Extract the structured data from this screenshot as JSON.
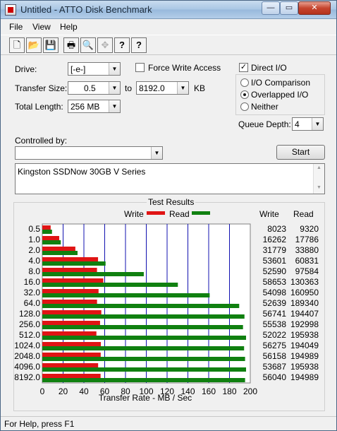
{
  "window": {
    "title": "Untitled - ATTO Disk Benchmark",
    "minimize": "—",
    "maximize": "▭",
    "close": "✕"
  },
  "menu": [
    "File",
    "View",
    "Help"
  ],
  "toolbar": {
    "icons": [
      "new-icon",
      "open-icon",
      "save-icon",
      "print-icon",
      "print-preview-icon",
      "move-icon",
      "help-icon",
      "context-help-icon"
    ],
    "glyphs": [
      "🗋",
      "📂",
      "💾",
      "🖶",
      "🔍",
      "✥",
      "?",
      "?"
    ]
  },
  "settings": {
    "drive_label": "Drive:",
    "drive_value": "[-e-]",
    "force_write_label": "Force Write Access",
    "direct_io_label": "Direct I/O",
    "transfer_size_label": "Transfer Size:",
    "transfer_from": "0.5",
    "to_label": "to",
    "transfer_to": "8192.0",
    "kb_unit": "KB",
    "total_length_label": "Total Length:",
    "total_length_value": "256 MB",
    "io_options": [
      "I/O Comparison",
      "Overlapped I/O",
      "Neither"
    ],
    "io_selected": 1,
    "queue_depth_label": "Queue Depth:",
    "queue_depth_value": "4",
    "controlled_by_label": "Controlled by:",
    "controlled_by_value": "",
    "start_label": "Start",
    "description": "Kingston SSDNow 30GB V Series"
  },
  "results": {
    "title": "Test Results",
    "legend_write": "Write",
    "legend_read": "Read",
    "col_write": "Write",
    "col_read": "Read",
    "xlabel": "Transfer Rate - MB / Sec"
  },
  "chart_data": {
    "type": "bar",
    "orientation": "horizontal",
    "categories": [
      "0.5",
      "1.0",
      "2.0",
      "4.0",
      "8.0",
      "16.0",
      "32.0",
      "64.0",
      "128.0",
      "256.0",
      "512.0",
      "1024.0",
      "2048.0",
      "4096.0",
      "8192.0"
    ],
    "series": [
      {
        "name": "Write",
        "color": "#e01414",
        "values": [
          8023,
          16262,
          31779,
          53601,
          52590,
          58653,
          54098,
          52639,
          56741,
          55538,
          52022,
          56275,
          56158,
          53687,
          56040
        ]
      },
      {
        "name": "Read",
        "color": "#108010",
        "values": [
          9320,
          17786,
          33880,
          60831,
          97584,
          130363,
          160950,
          189340,
          194407,
          192998,
          195938,
          194049,
          194989,
          195938,
          194989
        ]
      }
    ],
    "value_unit_divisor": 1000,
    "xlim": [
      0,
      200
    ],
    "xticks": [
      0,
      20,
      40,
      60,
      80,
      100,
      120,
      140,
      160,
      180,
      200
    ],
    "xlabel": "Transfer Rate - MB / Sec"
  },
  "status": {
    "text": "For Help, press F1"
  },
  "colors": {
    "grid": "#1010b0",
    "write": "#e01414",
    "read": "#108010"
  }
}
